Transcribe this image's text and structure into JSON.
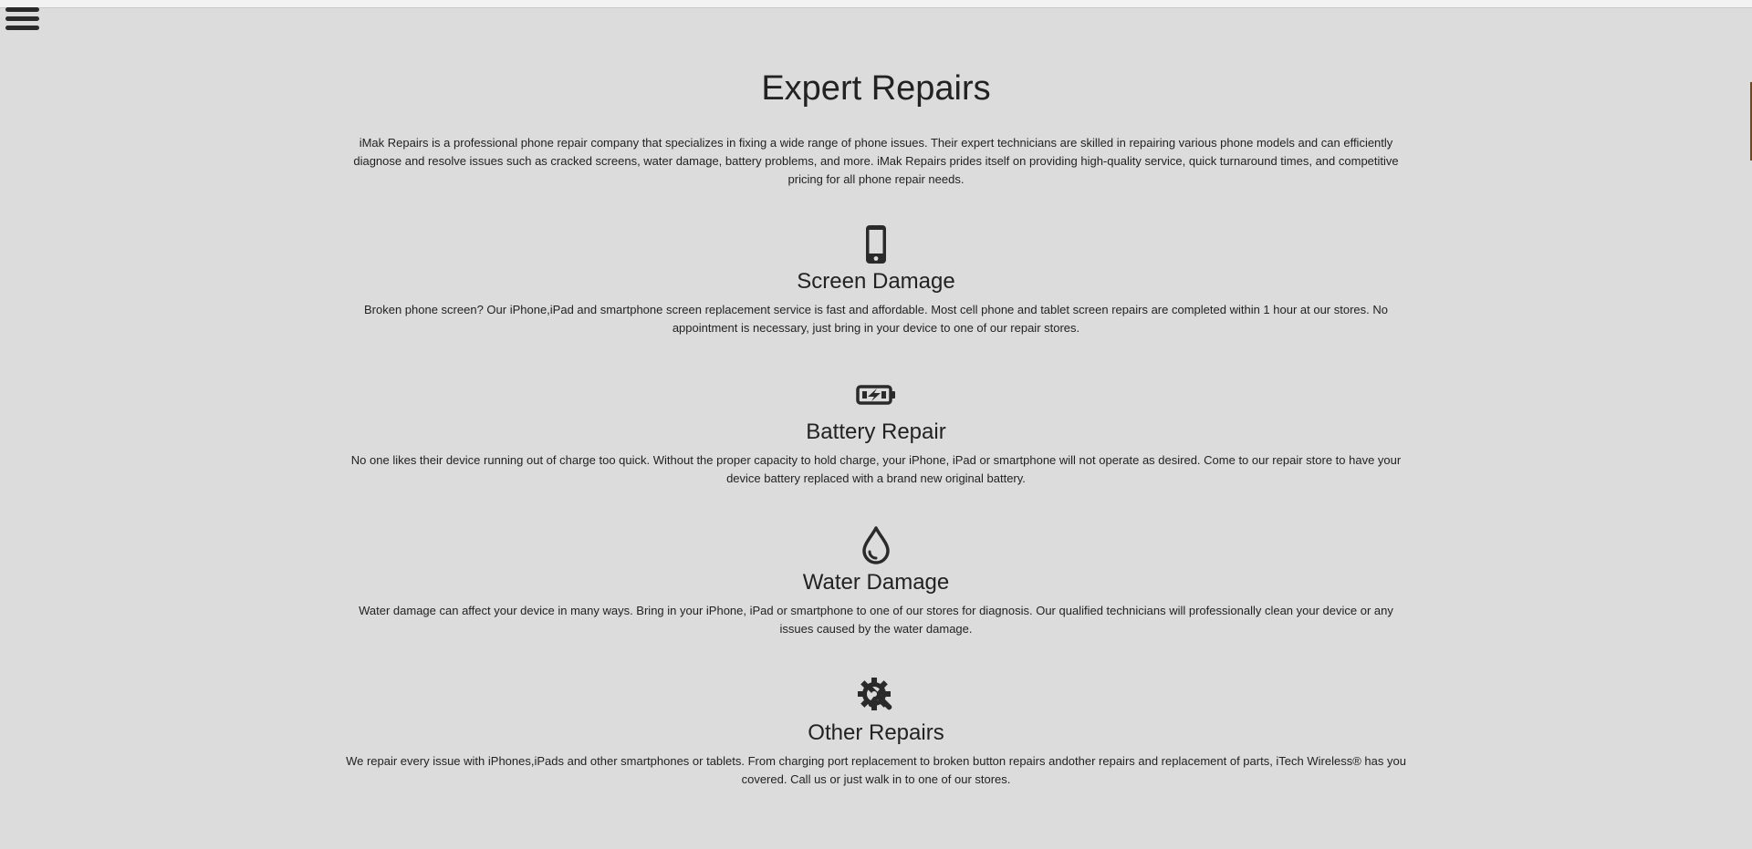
{
  "header": {
    "menu_icon": "hamburger-menu-icon"
  },
  "main": {
    "title": "Expert Repairs",
    "intro": "iMak Repairs is a professional phone repair company that specializes in fixing a wide range of phone issues. Their expert technicians are skilled in repairing various phone models and can efficiently diagnose and resolve issues such as cracked screens, water damage, battery problems, and more. iMak Repairs prides itself on providing high-quality service, quick turnaround times, and competitive pricing for all phone repair needs."
  },
  "services": [
    {
      "icon": "mobile-phone-icon",
      "title": "Screen Damage",
      "text": "Broken phone screen? Our iPhone,iPad and smartphone screen replacement service is fast and affordable. Most cell phone and tablet screen repairs are completed within 1 hour at our stores. No appointment is necessary, just bring in your device to one of our repair stores."
    },
    {
      "icon": "battery-charging-icon",
      "title": "Battery Repair",
      "text": "No one likes their device running out of charge too quick. Without the proper capacity to hold charge, your iPhone, iPad or smartphone will not operate as desired. Come to our repair store to have your device battery replaced with a brand new original battery."
    },
    {
      "icon": "water-drop-icon",
      "title": "Water Damage",
      "text": "Water damage can affect your device in many ways. Bring in your iPhone, iPad or smartphone to one of our stores for diagnosis. Our qualified technicians will professionally clean your device or any issues caused by the water damage."
    },
    {
      "icon": "gear-wrench-icon",
      "title": "Other Repairs",
      "text": "We repair every issue with iPhones,iPads and other smartphones or tablets. From charging port replacement to broken button repairs andother repairs and replacement of parts, iTech Wireless® has you covered. Call us or just walk in to one of our stores."
    }
  ],
  "colors": {
    "background": "#dcdcdc",
    "text": "#222222",
    "icon": "#2a2a2a"
  }
}
